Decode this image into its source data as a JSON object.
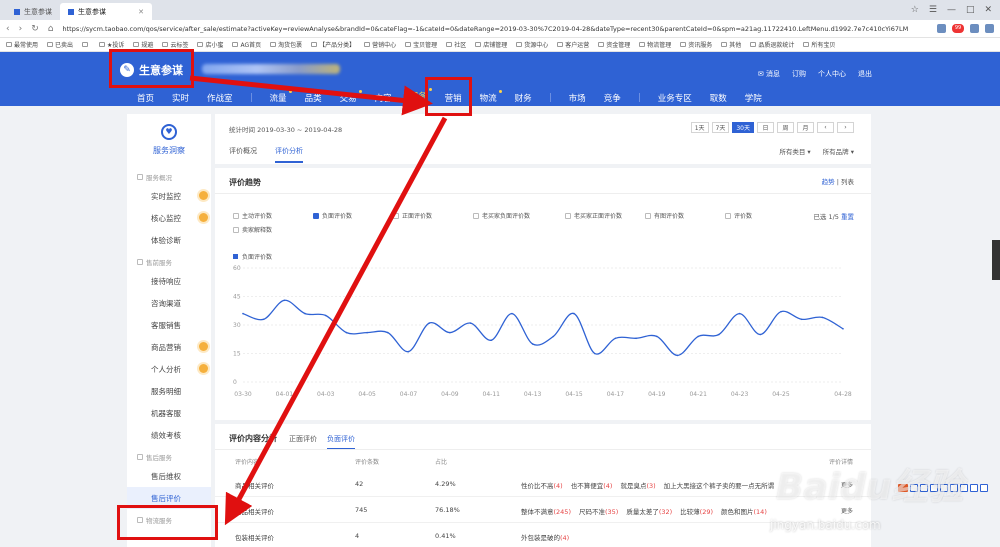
{
  "browser": {
    "tabs": [
      {
        "label": "生意参谋",
        "active": false
      },
      {
        "label": "生意参谋",
        "active": true
      }
    ],
    "window_controls": [
      "☆",
      "☰",
      "—",
      "□",
      "✕"
    ],
    "url": "https://sycm.taobao.com/qos/service/after_sale/estimate?activeKey=reviewAnalyse&brandId=0&cateFlag=-1&cateId=0&dateRange=2019-03-30%7C2019-04-28&dateType=recent30&parentCateId=0&spm=a21ag.11722410.LeftMenu.d1992.7e7c410cYi67LM",
    "extension_badge": "99",
    "bookmarks": [
      "最常使用",
      "已卖出",
      "",
      "★投诉",
      "规避",
      "云标签",
      "店小蜜",
      "AG首页",
      "淘货包裹",
      "【产品分类】",
      "营销中心",
      "宝贝管理",
      "社区",
      "店铺管理",
      "货源中心",
      "客户运营",
      "资金管理",
      "物流管理",
      "资讯服务",
      "其他",
      "品质退款统计",
      "所有宝贝"
    ]
  },
  "site": {
    "logo_text": "生意参谋",
    "top_links": [
      "消息",
      "订购",
      "个人中心",
      "退出"
    ],
    "nav": [
      {
        "label": "首页",
        "active": false,
        "dot": false
      },
      {
        "label": "实时",
        "active": false,
        "dot": false
      },
      {
        "label": "作战室",
        "active": false,
        "dot": false
      },
      {
        "label": "流量",
        "active": false,
        "dot": true
      },
      {
        "label": "品类",
        "active": false,
        "dot": false
      },
      {
        "label": "交易",
        "active": false,
        "dot": true
      },
      {
        "label": "内容",
        "active": false,
        "dot": false
      },
      {
        "label": "服务",
        "active": true,
        "dot": true
      },
      {
        "label": "营销",
        "active": false,
        "dot": false
      },
      {
        "label": "物流",
        "active": false,
        "dot": true
      },
      {
        "label": "财务",
        "active": false,
        "dot": false
      },
      {
        "label": "市场",
        "active": false,
        "dot": false
      },
      {
        "label": "竞争",
        "active": false,
        "dot": false
      },
      {
        "label": "业务专区",
        "active": false,
        "dot": false
      },
      {
        "label": "取数",
        "active": false,
        "dot": false
      },
      {
        "label": "学院",
        "active": false,
        "dot": false
      }
    ]
  },
  "sidebar": {
    "title": "服务洞察",
    "groups": [
      {
        "label": "服务概况",
        "items": [
          {
            "label": "实时监控",
            "dot": true
          },
          {
            "label": "核心监控",
            "dot": true
          },
          {
            "label": "体验诊断",
            "dot": false
          }
        ]
      },
      {
        "label": "售前服务",
        "items": [
          {
            "label": "接待响应",
            "dot": false
          },
          {
            "label": "咨询渠道",
            "dot": false
          },
          {
            "label": "客服销售",
            "dot": false
          },
          {
            "label": "商品营销",
            "dot": true
          },
          {
            "label": "个人分析",
            "dot": true
          },
          {
            "label": "服务明细",
            "dot": false
          },
          {
            "label": "机器客服",
            "dot": false
          },
          {
            "label": "绩效考核",
            "dot": false
          }
        ]
      },
      {
        "label": "售后服务",
        "items": [
          {
            "label": "售后维权",
            "dot": false
          },
          {
            "label": "售后评价",
            "dot": false,
            "active": true
          }
        ]
      },
      {
        "label": "物流服务",
        "items": []
      }
    ]
  },
  "filter": {
    "period_label": "统计时间 2019-03-30 ~ 2019-04-28",
    "ranges": [
      {
        "label": "1天",
        "active": false
      },
      {
        "label": "7天",
        "active": false
      },
      {
        "label": "30天",
        "active": true
      },
      {
        "label": "日",
        "active": false
      },
      {
        "label": "周",
        "active": false
      },
      {
        "label": "月",
        "active": false
      },
      {
        "label": "‹",
        "active": false
      },
      {
        "label": "›",
        "active": false
      }
    ],
    "subtabs": [
      {
        "label": "评价概况",
        "active": false
      },
      {
        "label": "评价分析",
        "active": true
      }
    ],
    "selects": [
      "所有类目 ▾",
      "所有品牌 ▾"
    ]
  },
  "trend": {
    "title": "评价趋势",
    "view_active": "趋势",
    "view_sep": " | ",
    "view_other": "列表",
    "metrics": [
      {
        "label": "主动评价数",
        "checked": false
      },
      {
        "label": "负面评价数",
        "checked": true
      },
      {
        "label": "正面评价数",
        "checked": false
      },
      {
        "label": "老买家负面评价数",
        "checked": false
      },
      {
        "label": "老买家正面评价数",
        "checked": false
      },
      {
        "label": "有图评价数",
        "checked": false
      },
      {
        "label": "评价数",
        "checked": false
      },
      {
        "label": "卖家解释数",
        "checked": false
      }
    ],
    "selected_text": "已选 1/5 ",
    "reset_label": "重置"
  },
  "chart_data": {
    "type": "line",
    "title": "",
    "xlabel": "",
    "ylabel": "",
    "ylim": [
      0,
      60
    ],
    "yticks": [
      0,
      15,
      30,
      45,
      60
    ],
    "grid": true,
    "legend": "top-left",
    "x": [
      "03-30",
      "03-31",
      "04-01",
      "04-02",
      "04-03",
      "04-04",
      "04-05",
      "04-06",
      "04-07",
      "04-08",
      "04-09",
      "04-10",
      "04-11",
      "04-12",
      "04-13",
      "04-14",
      "04-15",
      "04-16",
      "04-17",
      "04-18",
      "04-19",
      "04-20",
      "04-21",
      "04-22",
      "04-23",
      "04-24",
      "04-25",
      "04-26",
      "04-27",
      "04-28"
    ],
    "xticks": [
      "03-30",
      "04-01",
      "04-03",
      "04-05",
      "04-07",
      "04-09",
      "04-11",
      "04-13",
      "04-15",
      "04-17",
      "04-19",
      "04-21",
      "04-23",
      "04-25",
      "04-28"
    ],
    "series": [
      {
        "name": "负面评价数",
        "color": "#2f62d4",
        "values": [
          36,
          33,
          43,
          36,
          35,
          26,
          26,
          26,
          16,
          31,
          26,
          31,
          22,
          36,
          20,
          24,
          36,
          15,
          23,
          23,
          24,
          14,
          24,
          25,
          36,
          25,
          37,
          33,
          34,
          28
        ]
      }
    ]
  },
  "detail": {
    "title": "评价内容分析",
    "tabs": [
      {
        "label": "正面评价",
        "active": false
      },
      {
        "label": "负面评价",
        "active": true
      }
    ],
    "headers": [
      "评价内容",
      "评价条数",
      "占比",
      "",
      "评价详情"
    ],
    "rows": [
      {
        "name": "商品相关评价",
        "count": "42",
        "pct": "4.29%",
        "tags": [
          [
            "性价比不高",
            "(4)"
          ],
          [
            "也不算便宜",
            "(4)"
          ],
          [
            "就是臭点",
            "(3)"
          ],
          [
            "加上大黑接这个裤子卖的要一点无所谓",
            ""
          ]
        ],
        "more": "更多"
      },
      {
        "name": "商品相关评价",
        "count": "745",
        "pct": "76.18%",
        "tags": [
          [
            "整体不满意",
            "(245)"
          ],
          [
            "尺码不准",
            "(35)"
          ],
          [
            "质量太差了",
            "(32)"
          ],
          [
            "比较薄",
            "(29)"
          ],
          [
            "颜色和图片",
            "(14)"
          ]
        ],
        "more": "更多"
      },
      {
        "name": "包装相关评价",
        "count": "4",
        "pct": "0.41%",
        "tags": [
          [
            "外包装是破的",
            "(4)"
          ]
        ],
        "more": ""
      }
    ]
  },
  "watermark": {
    "brand": "Baidu经验",
    "url": "jingyan.baidu.com"
  },
  "annotation_color": "#e01010"
}
